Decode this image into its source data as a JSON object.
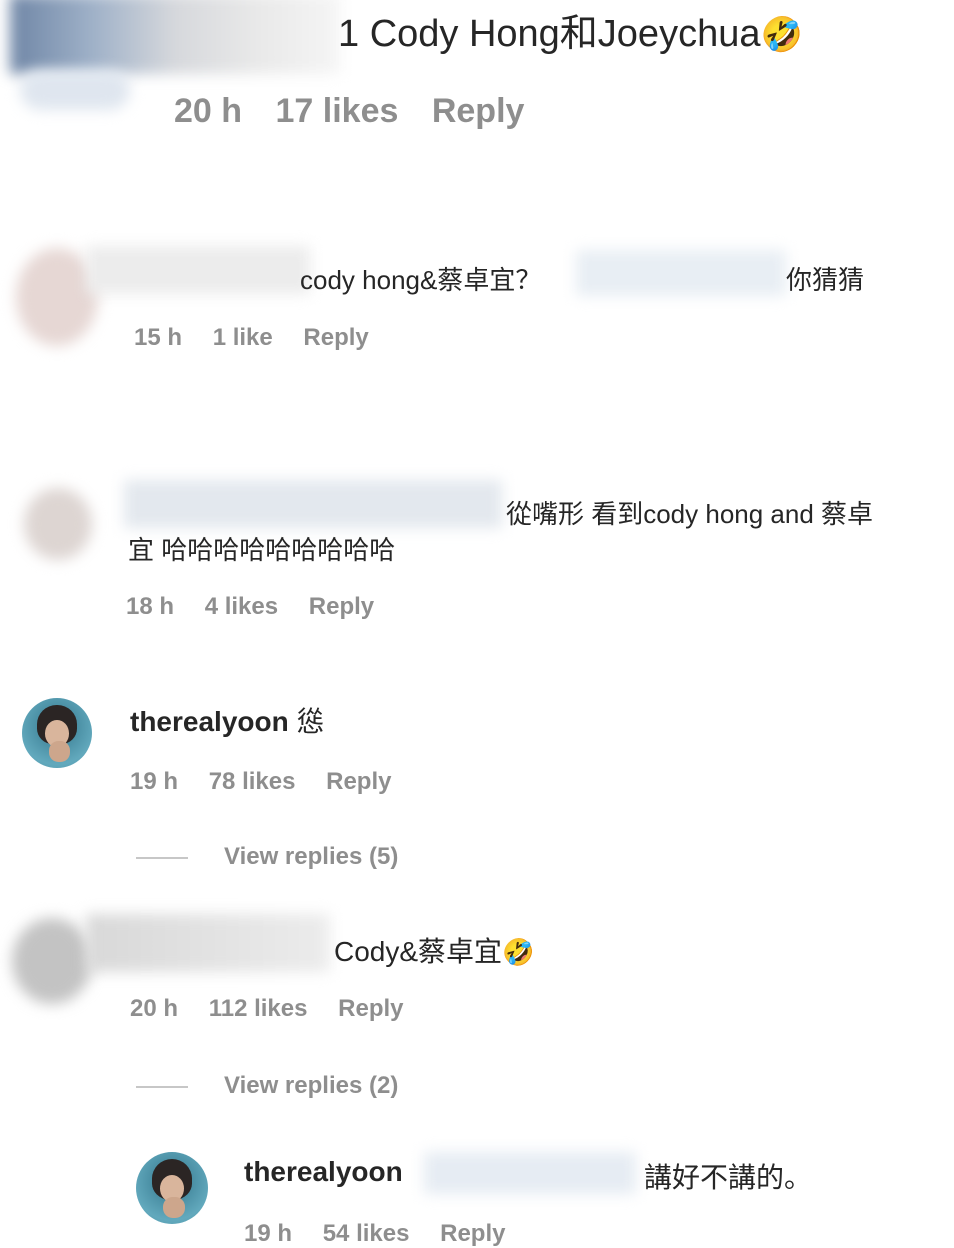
{
  "comment1": {
    "text": "1 Cody Hong和Joeychua",
    "emoji": "🤣",
    "time": "20 h",
    "likes": "17 likes",
    "reply": "Reply"
  },
  "comment2": {
    "text_visible": "cody hong&蔡卓宜？",
    "text_tail": "你猜猜",
    "time": "15 h",
    "likes": "1 like",
    "reply": "Reply"
  },
  "comment3": {
    "text_line1": "從嘴形 看到cody hong and 蔡卓",
    "text_line2": "宜 哈哈哈哈哈哈哈哈哈",
    "time": "18 h",
    "likes": "4 likes",
    "reply": "Reply"
  },
  "comment4": {
    "username": "therealyoon",
    "text": "慫",
    "time": "19 h",
    "likes": "78 likes",
    "reply": "Reply",
    "view_replies": "View replies (5)"
  },
  "comment5": {
    "text": "Cody&蔡卓宜",
    "emoji": "🤣",
    "time": "20 h",
    "likes": "112 likes",
    "reply": "Reply",
    "view_replies": "View replies (2)"
  },
  "reply1": {
    "username": "therealyoon",
    "text": "講好不講的。",
    "time": "19 h",
    "likes": "54 likes",
    "reply": "Reply"
  }
}
